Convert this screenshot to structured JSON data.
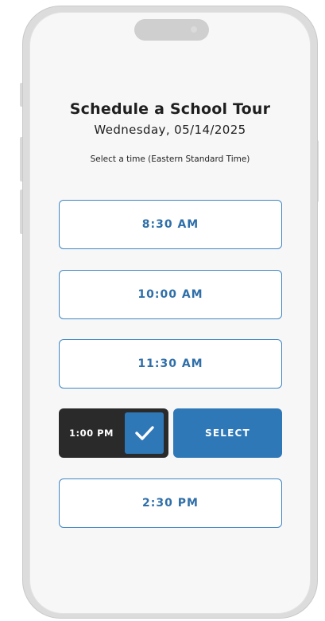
{
  "header": {
    "title": "Schedule a School Tour",
    "date": "Wednesday, 05/14/2025",
    "instruction": "Select a time (Eastern Standard Time)"
  },
  "time_slots": [
    {
      "label": "8:30 AM",
      "selected": false
    },
    {
      "label": "10:00 AM",
      "selected": false
    },
    {
      "label": "11:30 AM",
      "selected": false
    },
    {
      "label": "1:00 PM",
      "selected": true
    },
    {
      "label": "2:30 PM",
      "selected": false
    }
  ],
  "select_button": {
    "label": "SELECT"
  },
  "icons": {
    "selected_indicator": "checkmark-icon"
  },
  "colors": {
    "accent": "#2f78b8",
    "slot_text": "#2f6fa9",
    "slot_border": "#3f86c4",
    "selected_bg": "#2a2a2a"
  }
}
